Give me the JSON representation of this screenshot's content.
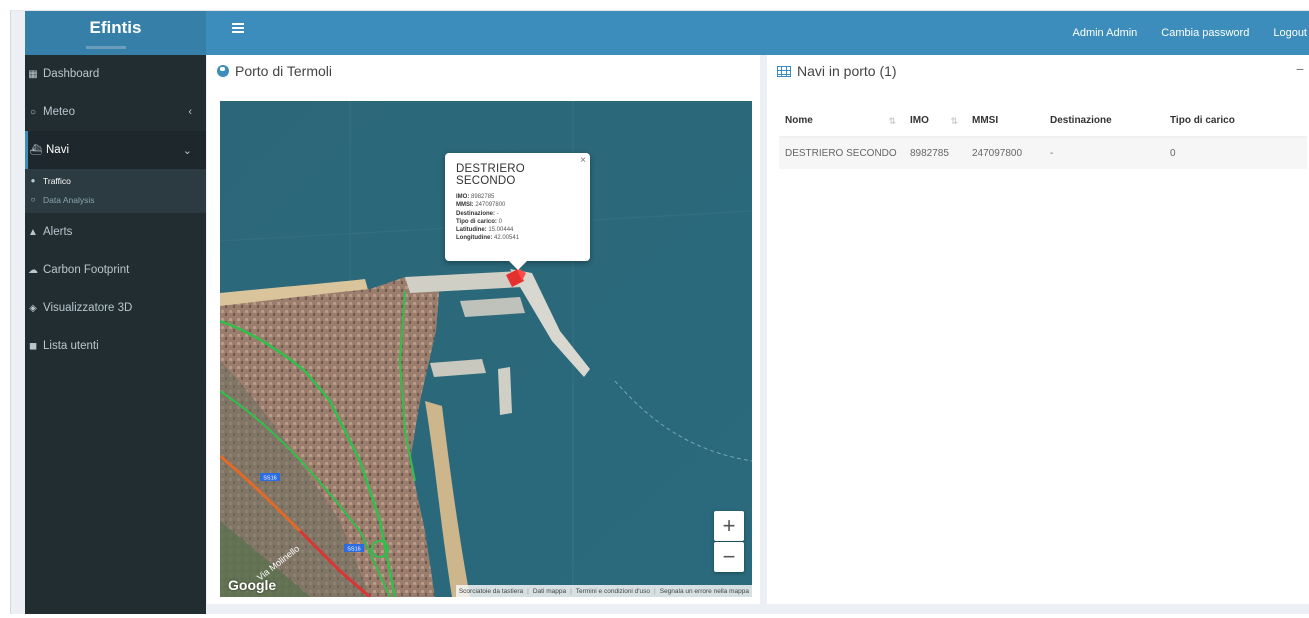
{
  "app": {
    "brand": "Efintis",
    "menu_icon": "hamburger-icon"
  },
  "topnav": {
    "user": "Admin Admin",
    "change_password": "Cambia password",
    "logout": "Logout"
  },
  "sidebar": {
    "items": [
      {
        "label": "Dashboard",
        "icon": "dashboard-icon"
      },
      {
        "label": "Meteo",
        "icon": "meteo-icon",
        "arrow": "‹"
      },
      {
        "label": "Navi",
        "icon": "ship-icon",
        "arrow": "⌄"
      },
      {
        "label": "Alerts",
        "icon": "warning-icon"
      },
      {
        "label": "Carbon Footprint",
        "icon": "cloud-icon"
      },
      {
        "label": "Visualizzatore 3D",
        "icon": "cube-icon"
      },
      {
        "label": "Lista utenti",
        "icon": "users-icon"
      }
    ],
    "submenu": [
      {
        "label": "Traffico",
        "icon": "filled-circle-icon"
      },
      {
        "label": "Data Analysis",
        "icon": "circle-icon"
      }
    ]
  },
  "map_panel": {
    "title": "Porto di Termoli",
    "zoom_in": "+",
    "zoom_out": "−",
    "google": "Google",
    "footer": {
      "shortcuts": "Scorciatoie da tastiera",
      "map_data": "Dati mappa",
      "terms": "Termini e condizioni d'uso",
      "report": "Segnala un errore nella mappa"
    },
    "popup": {
      "title": "DESTRIERO SECONDO",
      "close": "×",
      "imo_label": "IMO:",
      "imo": "8982785",
      "mmsi_label": "MMSI:",
      "mmsi": "247097800",
      "dest_label": "Destinazione:",
      "dest": "-",
      "cargo_label": "Tipo di carico:",
      "cargo": "0",
      "lat_label": "Latitudine:",
      "lat": "15.00444",
      "lon_label": "Longitudine:",
      "lon": "42.00541"
    },
    "road_labels": {
      "ss16_a": "SS16",
      "ss16_b": "SS16",
      "via_molinello": "Via Molinello"
    }
  },
  "table_panel": {
    "title": "Navi in porto (1)",
    "collapse": "−",
    "columns": [
      "Nome",
      "IMO",
      "MMSI",
      "Destinazione",
      "Tipo di carico"
    ],
    "sort_icon": "⇅",
    "rows": [
      [
        "DESTRIERO SECONDO",
        "8982785",
        "247097800",
        "-",
        "0"
      ]
    ]
  }
}
